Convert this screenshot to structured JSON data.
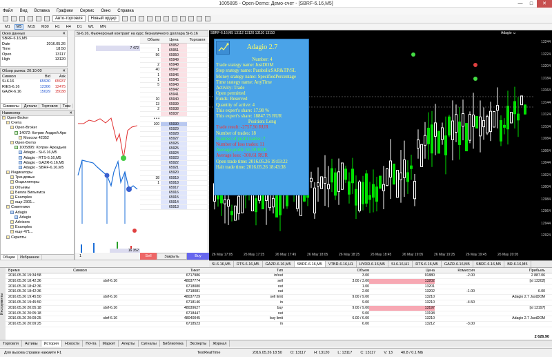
{
  "window": {
    "title": "1005895 - Open-Demo: Демо-счет - [SBRF-6.16,M5]"
  },
  "menu": [
    "Файл",
    "Вид",
    "Вставка",
    "Графики",
    "Сервис",
    "Окно",
    "Справка"
  ],
  "toolbar": {
    "autotrade": "Авто-торговля",
    "neworder": "Новый ордер"
  },
  "timeframes": [
    "M1",
    "M5",
    "M15",
    "M30",
    "H1",
    "H4",
    "D1",
    "W1",
    "MN"
  ],
  "active_tf": "M5",
  "data_window": {
    "title": "Окно данных",
    "rows": [
      {
        "k": "SBRF-6.16,M5",
        "v": ""
      },
      {
        "k": "Date",
        "v": "2016.05.26"
      },
      {
        "k": "Time",
        "v": "18:50"
      },
      {
        "k": "Open",
        "v": "13117"
      },
      {
        "k": "High",
        "v": "13120"
      }
    ]
  },
  "market_watch": {
    "title": "Обзор рынка: 20:10:00",
    "cols": [
      "Символ",
      "Bid",
      "Ask"
    ],
    "rows": [
      {
        "s": "Si-6.16",
        "b": "65930",
        "a": "65937"
      },
      {
        "s": "RIES-6.16",
        "b": "12306",
        "a": "12475"
      },
      {
        "s": "GAZR-6.16",
        "b": "15029",
        "a": "15038"
      }
    ],
    "tabs": [
      "Символы",
      "Детали",
      "Тортовля",
      "Тики"
    ]
  },
  "navigator": {
    "title": "Навигатор",
    "items": [
      "Open-Broker",
      "Счета",
      "Open-Broker",
      "14072: Котрин Андрей Ари",
      "Moscow 42352",
      "Open-Demo",
      "1005895: Котрин Аркадьев",
      "Adagio - Si-6.16,M5",
      "Adagio - RTS-6.16,M5",
      "Adagio - GAZR-6.16,M5",
      "Adagio - SBRF-6.16,M5",
      "Индикаторы",
      "Трендовые",
      "Осцилляторы",
      "Объемы",
      "Билла Вильямса",
      "Examples",
      "еще 2301...",
      "Советники",
      "Adagio",
      "Adagio",
      "Advisors",
      "Examples",
      "еще 471...",
      "Скрипты"
    ],
    "tabs": [
      "Общие",
      "Избранное"
    ]
  },
  "dom": {
    "title": "Si-6.16, Фьючерсный контракт на курс безналичного доллара Si-6.16",
    "cols": [
      "Объем",
      "Цена",
      "Торговля"
    ],
    "rows": [
      {
        "v": "",
        "p": "65952",
        "t": "ask"
      },
      {
        "v": "1",
        "p": "65951",
        "t": "ask"
      },
      {
        "v": "56",
        "p": "65950",
        "t": "ask"
      },
      {
        "v": "",
        "p": "65949",
        "t": "ask"
      },
      {
        "v": "2",
        "p": "65948",
        "t": "ask"
      },
      {
        "v": "40",
        "p": "65947",
        "t": "ask"
      },
      {
        "v": "1",
        "p": "65946",
        "t": "ask"
      },
      {
        "v": "1",
        "p": "65945",
        "t": "ask"
      },
      {
        "v": "5",
        "p": "65943",
        "t": "ask"
      },
      {
        "v": "",
        "p": "65942",
        "t": "ask"
      },
      {
        "v": "",
        "p": "65941",
        "t": "ask"
      },
      {
        "v": "10",
        "p": "65940",
        "t": "ask"
      },
      {
        "v": "13",
        "p": "65939",
        "t": "ask"
      },
      {
        "v": "2",
        "p": "65938",
        "t": "ask"
      },
      {
        "v": "",
        "p": "65937",
        "t": "ask"
      },
      {
        "v": "• • •",
        "p": "",
        "t": "gap"
      },
      {
        "v": "100",
        "p": "65930",
        "t": "cur"
      },
      {
        "v": "",
        "p": "65929",
        "t": "bid"
      },
      {
        "v": "",
        "p": "65928",
        "t": "bid"
      },
      {
        "v": "",
        "p": "65927",
        "t": "bid"
      },
      {
        "v": "",
        "p": "65926",
        "t": "bid"
      },
      {
        "v": "",
        "p": "65925",
        "t": "bid"
      },
      {
        "v": "",
        "p": "65924",
        "t": "bid"
      },
      {
        "v": "",
        "p": "65923",
        "t": "bid"
      },
      {
        "v": "",
        "p": "65922",
        "t": "bid"
      },
      {
        "v": "",
        "p": "65921",
        "t": "bid"
      },
      {
        "v": "",
        "p": "65920",
        "t": "bid"
      },
      {
        "v": "38",
        "p": "65919",
        "t": "bid"
      },
      {
        "v": "1",
        "p": "65918",
        "t": "bid"
      },
      {
        "v": "",
        "p": "65917",
        "t": "bid"
      },
      {
        "v": "",
        "p": "65916",
        "t": "bid"
      },
      {
        "v": "",
        "p": "65915",
        "t": "bid"
      },
      {
        "v": "",
        "p": "65914",
        "t": "bid"
      },
      {
        "v": "",
        "p": "65913",
        "t": "bid"
      }
    ],
    "top_vol": "7 472",
    "bottom_vol": "16 352",
    "qty": "1",
    "btn_sell": "Sell",
    "btn_close": "Закрыть",
    "btn_buy": "Buy"
  },
  "chart": {
    "title": "SBRF-6.16,M5 13112 13120 13110 13110",
    "label": "Adagio ☺",
    "y_ticks": [
      "13244",
      "13224",
      "13204",
      "13184",
      "13164",
      "13144",
      "13124",
      "13104",
      "13084",
      "13064",
      "13044",
      "13024",
      "13004",
      "12984",
      "12964",
      "12944",
      "12924"
    ],
    "x_ticks": [
      "26 May 17:05",
      "26 May 17:25",
      "26 May 17:45",
      "26 May 18:05",
      "26 May 18:25",
      "26 May 18:45",
      "26 May 19:05",
      "26 May 19:25",
      "26 May 19:45",
      "26 May 20:05"
    ]
  },
  "adagio_panel": {
    "title": "Adagio 2.7",
    "lines": [
      {
        "text": "Number: 4",
        "c": "t",
        "center": true
      },
      {
        "text": "Trade srategy name: JustDOM",
        "c": "t"
      },
      {
        "text": "Stop srategy name: ParabolicSAR&TP/SL",
        "c": "t"
      },
      {
        "text": "Money srategy name: SpecifiedPercentage",
        "c": "t"
      },
      {
        "text": "Time srategy name: AnyTime",
        "c": "t"
      },
      {
        "text": "Activity: Trade",
        "c": "t"
      },
      {
        "text": "Open permitted",
        "c": "t"
      },
      {
        "text": "Funds: Reserved",
        "c": "t"
      },
      {
        "text": "Quantity of active: 4",
        "c": "t"
      },
      {
        "text": "This expert's share: 17.98 %",
        "c": "t"
      },
      {
        "text": "This expert's share: 18847.75  RUR",
        "c": "t"
      },
      {
        "text": "Position: Long",
        "c": "t",
        "center": true
      },
      {
        "text": "Trade result: -2757.50 RUR",
        "c": "red"
      },
      {
        "text": "Number of trades: 18",
        "c": "t"
      },
      {
        "text": "Number of profit trades: 7",
        "c": "green"
      },
      {
        "text": "Number of loss trades: 11",
        "c": "red"
      },
      {
        "text": "Average profit: 61.59  RUR",
        "c": "green"
      },
      {
        "text": "Average loss: -300.61  RUR",
        "c": "red"
      },
      {
        "text": "Open trade time: 2016.05.26 19:03:22",
        "c": "t"
      },
      {
        "text": "Halt trade time: 2016.05.26 18:43:38",
        "c": "t"
      }
    ]
  },
  "chart_tabs": [
    "SI-6.16,M5",
    "RTS-6.16,M5",
    "GAZR-6.16,M5",
    "SBRF-6.16,M5",
    "VTBR-6.16,H1",
    "HYDR-6.16,M5",
    "SI-6.16,H1",
    "RTS-6.16,M5",
    "GAZR-6.16,M5",
    "SBRF-6.16,M5",
    "BR-6.16,M5"
  ],
  "active_chart_tab": "SBRF-6.16,M5",
  "history": {
    "cols": [
      "Время",
      "Символ",
      "Тикет",
      "Тип",
      "Объем",
      "Цена",
      "Комиссия",
      "Прибыль"
    ],
    "rows": [
      {
        "time": "2016.05.26 19:34:58",
        "sym": "",
        "tick": "6717986",
        "type": "in/out",
        "vol": "3.00",
        "price": "91880",
        "comm": "-2.00",
        "prof": "2 887.06",
        "hl": false
      },
      {
        "time": "2016.05.26 18:42:36",
        "sym": "sbrf-6.16",
        "tick": "48037774",
        "type": "sell",
        "vol": "3.00 / 3.00",
        "price": "13202",
        "comm": "",
        "prof": "[sl 13202]",
        "hl": true
      },
      {
        "time": "2016.05.26 18:42:36",
        "sym": "",
        "tick": "6718080",
        "type": "out",
        "vol": "1.00",
        "price": "13201",
        "comm": "",
        "prof": "",
        "hl": false
      },
      {
        "time": "2016.05.26 18:42:36",
        "sym": "",
        "tick": "6718081",
        "type": "out",
        "vol": "2.00",
        "price": "13202",
        "comm": "-1.00",
        "prof": "6.00",
        "hl": false
      },
      {
        "time": "2016.05.26 19:45:50",
        "sym": "sbrf-6.16",
        "tick": "48037729",
        "type": "sell limit",
        "vol": "9.00 / 9.00",
        "price": "13210",
        "comm": "",
        "prof": "Adagio 2.7 JustDOM",
        "hl": false
      },
      {
        "time": "2016.05.26 19:45:50",
        "sym": "",
        "tick": "6718146",
        "type": "in",
        "vol": "9.00",
        "price": "13210",
        "comm": "-4.50",
        "prof": "",
        "hl": false
      },
      {
        "time": "2016.05.26 20:05:18",
        "sym": "sbrf-6.16",
        "tick": "48039627",
        "type": "buy",
        "vol": "9.00 / 9.00",
        "price": "13197",
        "comm": "",
        "prof": "[sl 13197]",
        "hl": true
      },
      {
        "time": "2016.05.26 20:05:18",
        "sym": "",
        "tick": "6718447",
        "type": "out",
        "vol": "9.00",
        "price": "13198",
        "comm": "",
        "prof": "",
        "hl": false
      },
      {
        "time": "2016.05.26 20:09:25",
        "sym": "sbrf-6.16",
        "tick": "48040045",
        "type": "buy limit",
        "vol": "6.00 / 6.00",
        "price": "13210",
        "comm": "",
        "prof": "Adagio 2.7 JustDOM",
        "hl": false
      },
      {
        "time": "2016.05.26 20:09:25",
        "sym": "",
        "tick": "6718523",
        "type": "in",
        "vol": "6.00",
        "price": "13212",
        "comm": "-3.00",
        "prof": "",
        "hl": false
      }
    ],
    "total": "2 626.90"
  },
  "bottom_tabs": [
    "Торговля",
    "Активы",
    "История",
    "Новости",
    "Почта",
    "Маркет",
    "Алерты",
    "Сигналы",
    "Библиотека",
    "Эксперты",
    "Журнал"
  ],
  "active_bottom_tab": "История",
  "toolbox_label": "Инструменты",
  "status": {
    "help": "Для вызова справки нажмите F1",
    "mode": "TestRealTime",
    "dt": "2016.05.26 18:50",
    "o": "O: 13117",
    "h": "H: 13120",
    "l": "L: 13117",
    "c": "C: 13117",
    "v": "V: 13",
    "traffic": "40.8 / 0.1 Mb"
  },
  "colors": {
    "chart_bg": "#000000",
    "bull": "#00e000",
    "bear": "#ffffff",
    "panel_bg": "#4aa3e8",
    "panel_text": "#ffff66"
  }
}
